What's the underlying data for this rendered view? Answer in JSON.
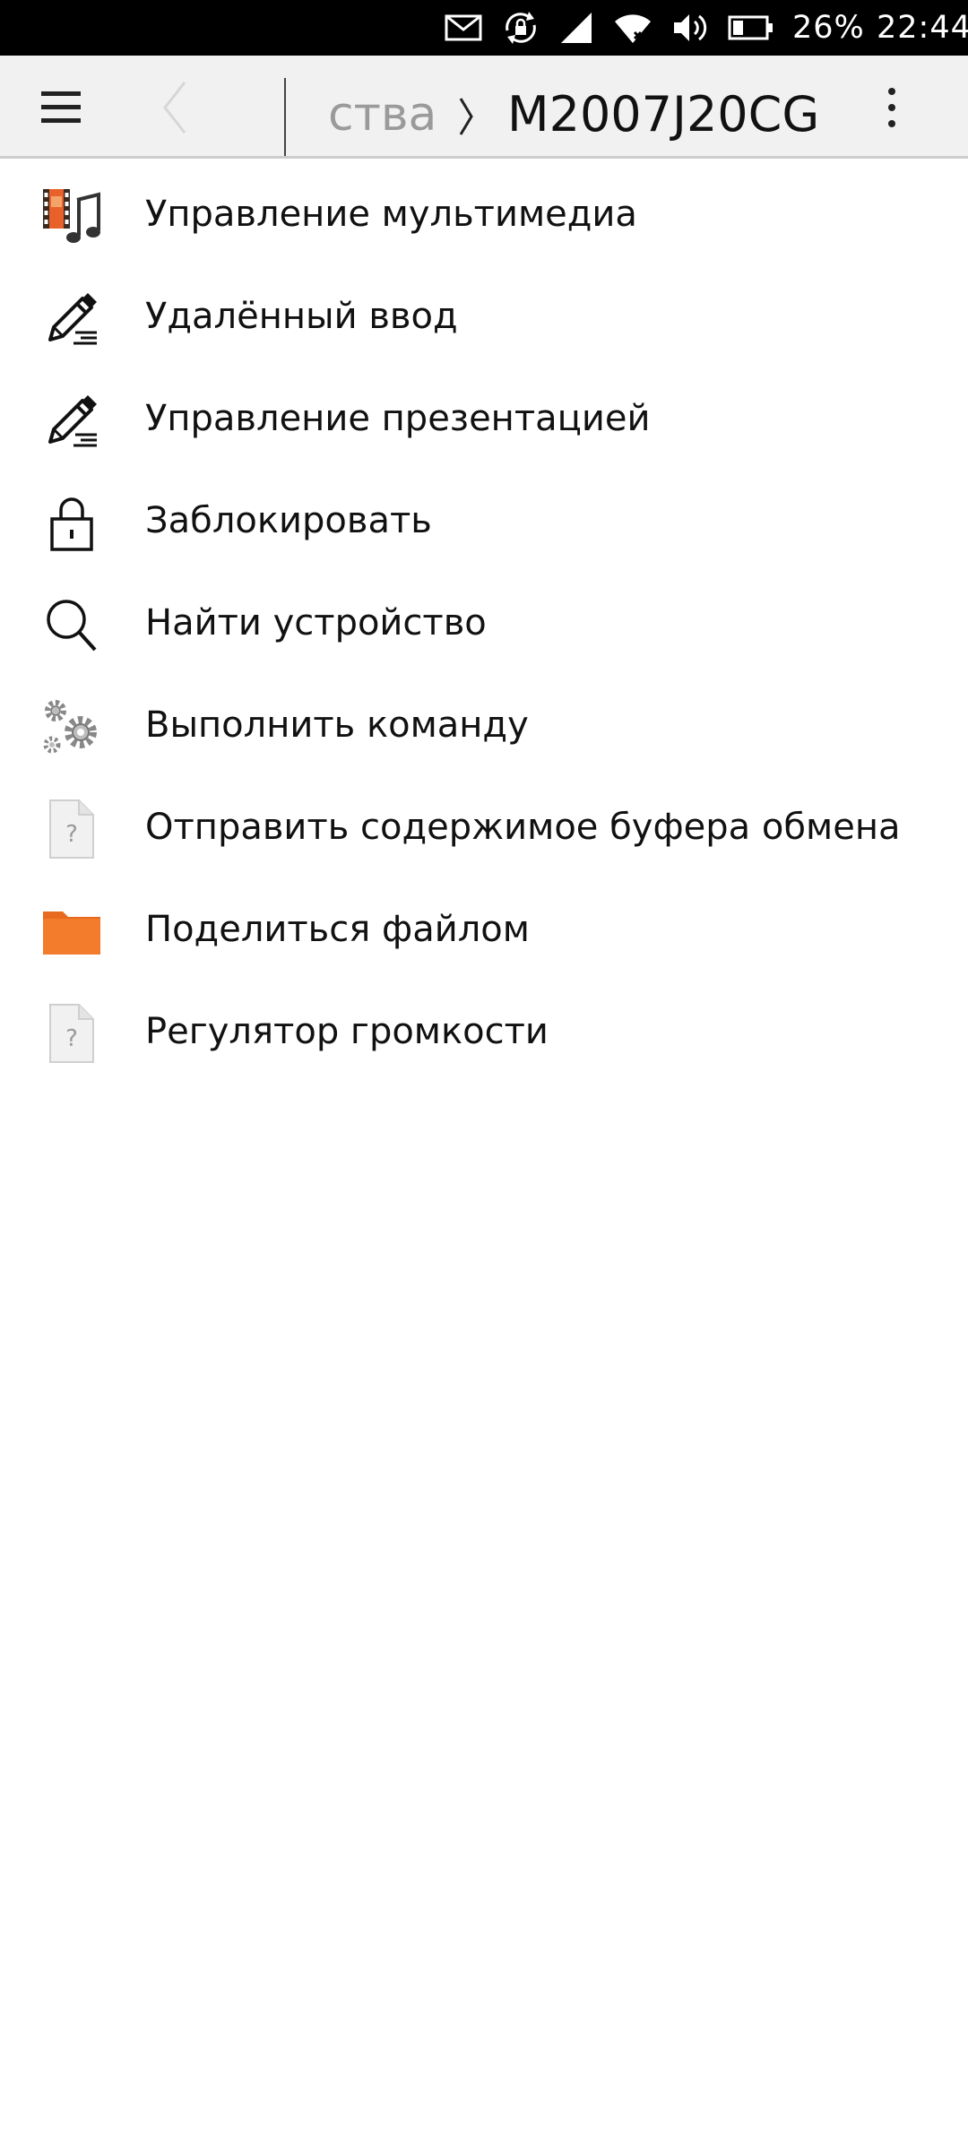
{
  "status_bar": {
    "battery_percent": "26%",
    "time": "22:44"
  },
  "header": {
    "breadcrumb_prev": "ства",
    "title": "M2007J20CG"
  },
  "items": [
    {
      "label": "Управление мультимедиа",
      "icon": "multimedia-icon"
    },
    {
      "label": "Удалённый ввод",
      "icon": "pen-icon"
    },
    {
      "label": "Управление презентацией",
      "icon": "pen-icon"
    },
    {
      "label": "Заблокировать",
      "icon": "lock-icon"
    },
    {
      "label": "Найти устройство",
      "icon": "search-icon"
    },
    {
      "label": "Выполнить команду",
      "icon": "gears-icon"
    },
    {
      "label": "Отправить содержимое буфера обмена",
      "icon": "unknown-file-icon"
    },
    {
      "label": "Поделиться файлом",
      "icon": "folder-icon"
    },
    {
      "label": "Регулятор громкости",
      "icon": "unknown-file-icon"
    }
  ],
  "colors": {
    "status_bar_bg": "#000000",
    "header_bg": "#f1f1f1",
    "folder_orange": "#f27b2c",
    "text": "#111111",
    "muted_text": "#9a9a9a"
  }
}
